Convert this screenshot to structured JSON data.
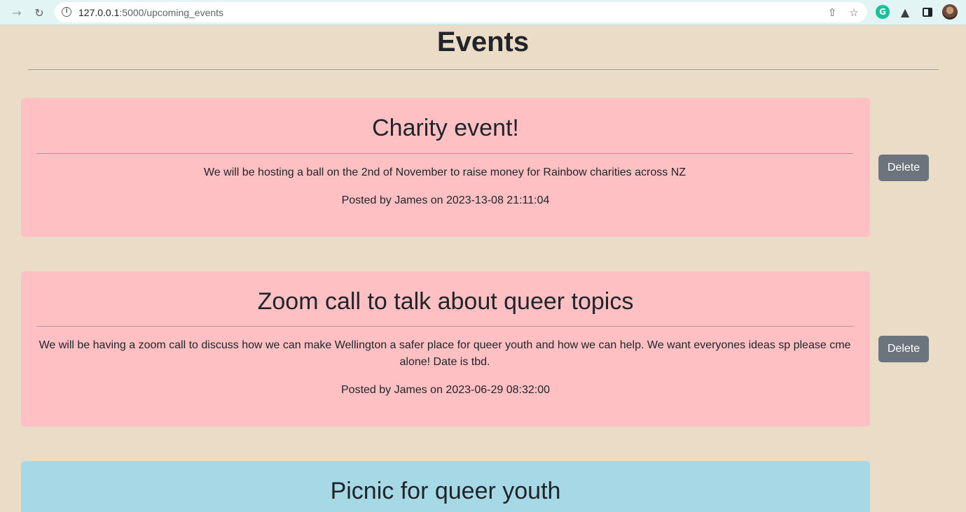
{
  "browser": {
    "url_host": "127.0.0.1",
    "url_rest": ":5000/upcoming_events",
    "icons": [
      "forward-icon",
      "reload-icon",
      "site-info-icon",
      "share-icon",
      "star-icon",
      "grammarly-icon",
      "puzzle-icon",
      "sidepanel-icon",
      "avatar"
    ]
  },
  "page": {
    "title": "Events"
  },
  "events": [
    {
      "title": "Charity event!",
      "description": "We will be hosting a ball on the 2nd of November to raise money for Rainbow charities across NZ",
      "meta": "Posted by James on 2023-13-08 21:11:04",
      "delete_label": "Delete",
      "color": "#ffc0c4"
    },
    {
      "title": "Zoom call to talk about queer topics",
      "description": "We will be having a zoom call to discuss how we can make Wellington a safer place for queer youth and how we can help. We want everyones ideas sp please cme alone! Date is tbd.",
      "meta": "Posted by James on 2023-06-29 08:32:00",
      "delete_label": "Delete",
      "color": "#ffc0c4"
    },
    {
      "title": "Picnic for queer youth",
      "color": "#a6d8e6"
    }
  ],
  "colors": {
    "background": "#eadcc6",
    "delete_button": "#6c757d"
  }
}
